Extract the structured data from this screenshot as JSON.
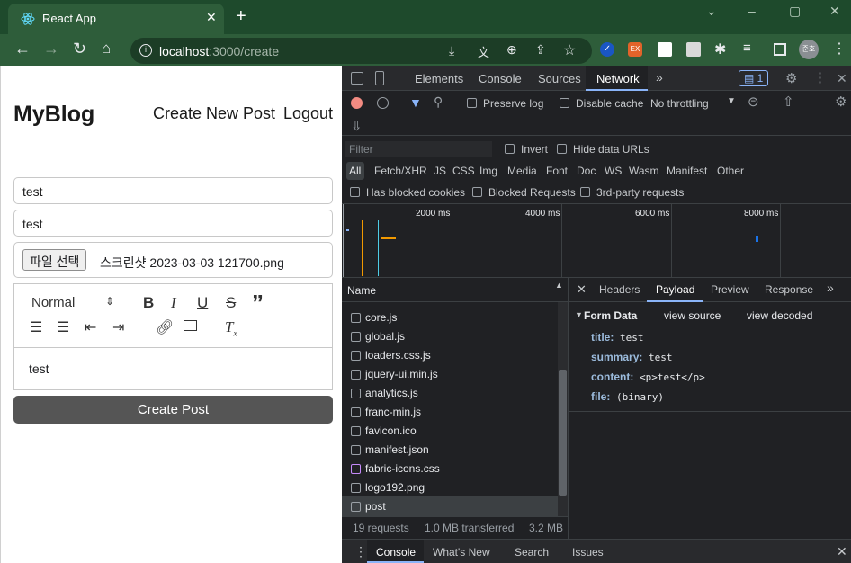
{
  "browser": {
    "tab_title": "React App",
    "url_host": "localhost",
    "url_path": ":3000/create",
    "profile_initials": "준호"
  },
  "app": {
    "logo": "MyBlog",
    "nav": {
      "create": "Create New Post",
      "logout": "Logout"
    },
    "title_value": "test",
    "summary_value": "test",
    "file_button": "파일 선택",
    "file_name": "스크린샷 2023-03-03 121700.png",
    "editor": {
      "heading_select": "Normal",
      "content": "test"
    },
    "submit_label": "Create Post"
  },
  "devtools": {
    "tabs": [
      "Elements",
      "Console",
      "Sources",
      "Network"
    ],
    "active_tab": "Network",
    "issues_count": "1",
    "preserve_log": "Preserve log",
    "disable_cache": "Disable cache",
    "throttling": "No throttling",
    "filter_placeholder": "Filter",
    "invert": "Invert",
    "hide_data_urls": "Hide data URLs",
    "type_filters": [
      "All",
      "Fetch/XHR",
      "JS",
      "CSS",
      "Img",
      "Media",
      "Font",
      "Doc",
      "WS",
      "Wasm",
      "Manifest",
      "Other"
    ],
    "has_blocked_cookies": "Has blocked cookies",
    "blocked_requests": "Blocked Requests",
    "third_party": "3rd-party requests",
    "timeline_ticks": [
      "2000 ms",
      "4000 ms",
      "6000 ms",
      "8000 ms"
    ],
    "name_header": "Name",
    "requests": [
      "core.js",
      "global.js",
      "loaders.css.js",
      "jquery-ui.min.js",
      "analytics.js",
      "franc-min.js",
      "favicon.ico",
      "manifest.json",
      "fabric-icons.css",
      "logo192.png",
      "post"
    ],
    "detail_tabs": [
      "Headers",
      "Payload",
      "Preview",
      "Response"
    ],
    "active_detail_tab": "Payload",
    "form_data": {
      "heading": "Form Data",
      "view_source": "view source",
      "view_decoded": "view decoded",
      "fields": [
        {
          "key": "title:",
          "value": "test"
        },
        {
          "key": "summary:",
          "value": "test"
        },
        {
          "key": "content:",
          "value": "<p>test</p>"
        },
        {
          "key": "file:",
          "value": "(binary)"
        }
      ]
    },
    "status": {
      "requests": "19 requests",
      "transferred": "1.0 MB transferred",
      "resources": "3.2 MB"
    },
    "drawer_tabs": [
      "Console",
      "What's New",
      "Search",
      "Issues"
    ]
  },
  "colors": {
    "titlebar": "#1e4a2c",
    "toolbar": "#2e5d3a",
    "devtools_bg": "#202124",
    "accent_blue": "#8ab4f8"
  }
}
